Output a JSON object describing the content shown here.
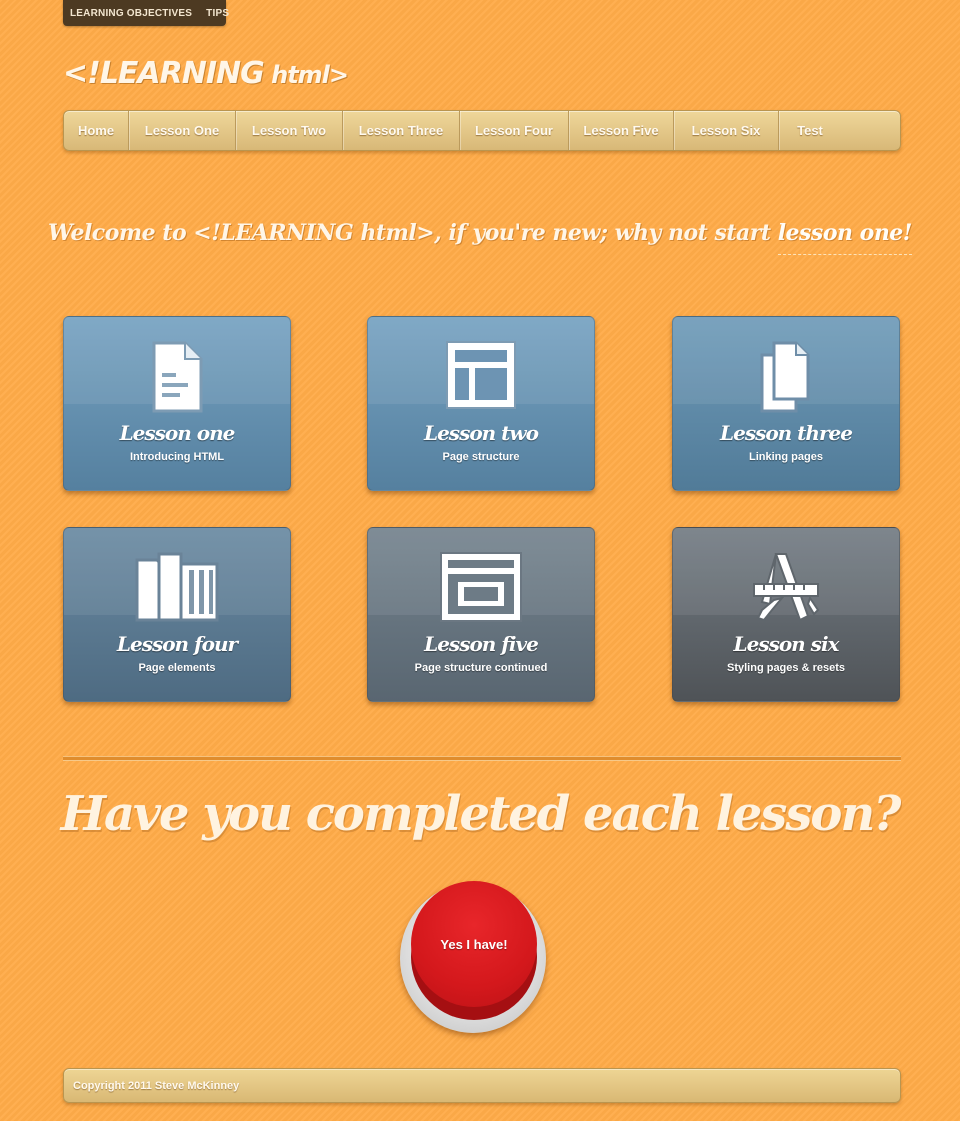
{
  "topbar": {
    "links": [
      "LEARNING OBJECTIVES",
      "TIPS"
    ]
  },
  "logo": {
    "main": "<!LEARNING",
    "small": " html>"
  },
  "nav": {
    "items": [
      "Home",
      "Lesson One",
      "Lesson Two",
      "Lesson Three",
      "Lesson Four",
      "Lesson Five",
      "Lesson Six",
      "Test"
    ]
  },
  "welcome": {
    "prefix": "Welcome to <!LEARNING html>, if you're new; why not start ",
    "link": "lesson one!"
  },
  "lessons": [
    {
      "title": "Lesson one",
      "subtitle": "Introducing HTML",
      "icon": "document-icon",
      "color": "#6a95b4"
    },
    {
      "title": "Lesson two",
      "subtitle": "Page structure",
      "icon": "layout-icon",
      "color": "#6a95b4"
    },
    {
      "title": "Lesson three",
      "subtitle": "Linking pages",
      "icon": "documents-icon",
      "color": "#628dab"
    },
    {
      "title": "Lesson four",
      "subtitle": "Page elements",
      "icon": "page-elements-icon",
      "color": "#5d7c94"
    },
    {
      "title": "Lesson five",
      "subtitle": "Page structure continued",
      "icon": "window-icon",
      "color": "#67757f"
    },
    {
      "title": "Lesson six",
      "subtitle": "Styling pages & resets",
      "icon": "styling-tools-icon",
      "color": "#62686d"
    }
  ],
  "question": "Have you completed each lesson?",
  "confirm_button": "Yes I have!",
  "footer": "Copyright 2011 Steve McKinney",
  "colors": {
    "background": "#ffab48",
    "nav": "#e3c684",
    "button_red": "#d4181c"
  }
}
